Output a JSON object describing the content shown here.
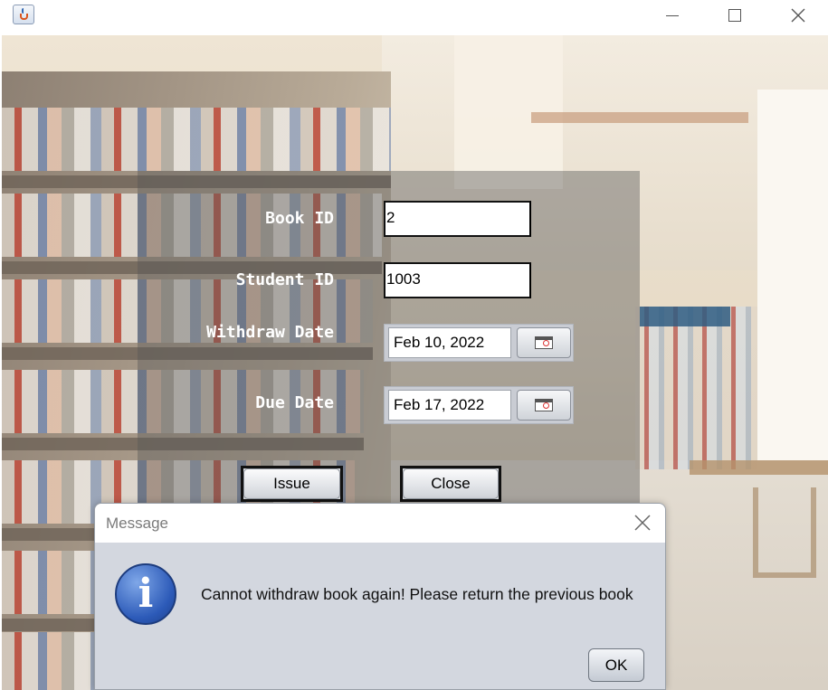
{
  "window": {
    "icon": "java-cup-icon",
    "controls": {
      "minimize": "minimize-icon",
      "maximize": "maximize-icon",
      "close": "close-icon"
    }
  },
  "form": {
    "book_id_label": "Book ID",
    "book_id_value": "2",
    "student_id_label": "Student ID",
    "student_id_value": "1003",
    "withdraw_date_label": "Withdraw Date",
    "withdraw_date_value": "Feb 10, 2022",
    "due_date_label": "Due Date",
    "due_date_value": "Feb 17, 2022",
    "issue_label": "Issue",
    "close_label": "Close"
  },
  "dialog": {
    "title": "Message",
    "message": "Cannot withdraw book again! Please return the previous book",
    "ok_label": "OK",
    "icon": "info-icon"
  },
  "colors": {
    "panel_overlay": "#555555",
    "dialog_body": "#d3d7df",
    "info_icon_blue": "#2c5ab8"
  }
}
